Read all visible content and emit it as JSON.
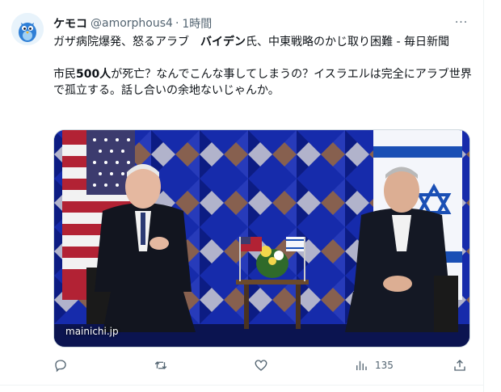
{
  "tweet": {
    "display_name": "ケモコ",
    "handle": "@amorphous4",
    "separator": "·",
    "time": "1時間",
    "more_label": "···",
    "line1_a": "ガザ病院爆発、怒るアラブ　",
    "line1_bold": "バイデン",
    "line1_b": "氏、中東戦略のかじ取り困難 - 毎日新聞",
    "line2_a": "市民",
    "line2_bold": "500人",
    "line2_b": "が死亡？なんでこんな事してしまうの？イスラエルは完全にアラブ世界で孤立する。話し合いの余地ないじゃんか。"
  },
  "media": {
    "watermark": "mainichi.jp"
  },
  "actions": {
    "reply": "reply-icon",
    "retweet": "retweet-icon",
    "like": "heart-icon",
    "views": "views-icon",
    "views_count": "135",
    "share": "share-icon"
  },
  "colors": {
    "text": "#0f1419",
    "secondary": "#536471",
    "border": "#cfd9de",
    "backdrop_blue": "#1b35c9"
  }
}
